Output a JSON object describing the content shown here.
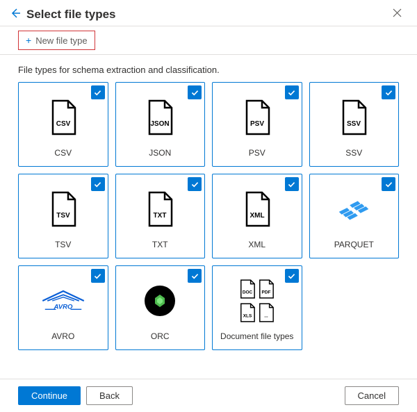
{
  "header": {
    "title": "Select file types"
  },
  "toolbar": {
    "new_file_type": "New file type"
  },
  "description": "File types for schema extraction and classification.",
  "tiles": [
    {
      "ext": "CSV",
      "label": "CSV",
      "kind": "file"
    },
    {
      "ext": "JSON",
      "label": "JSON",
      "kind": "file"
    },
    {
      "ext": "PSV",
      "label": "PSV",
      "kind": "file"
    },
    {
      "ext": "SSV",
      "label": "SSV",
      "kind": "file"
    },
    {
      "ext": "TSV",
      "label": "TSV",
      "kind": "file"
    },
    {
      "ext": "TXT",
      "label": "TXT",
      "kind": "file"
    },
    {
      "ext": "XML",
      "label": "XML",
      "kind": "file"
    },
    {
      "ext": "",
      "label": "PARQUET",
      "kind": "parquet"
    },
    {
      "ext": "",
      "label": "AVRO",
      "kind": "avro"
    },
    {
      "ext": "",
      "label": "ORC",
      "kind": "orc"
    },
    {
      "ext": "",
      "label": "Document file types",
      "kind": "docs"
    }
  ],
  "doc_exts": [
    "DOC",
    "PDF",
    "XLS",
    "..."
  ],
  "footer": {
    "continue": "Continue",
    "back": "Back",
    "cancel": "Cancel"
  },
  "colors": {
    "primary": "#0078d4",
    "highlight": "#d13438"
  }
}
